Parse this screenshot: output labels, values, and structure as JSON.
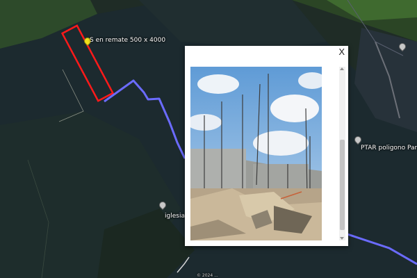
{
  "map": {
    "labels": {
      "plot": "S en remate 500 x 4000",
      "ptar": "PTAR poligono Paraiso",
      "church": "iglesia de",
      "copyright": "© 2024 ..."
    },
    "icons": {
      "plot_marker": "yellow-pushpin-icon",
      "ptar_marker": "place-pin-icon",
      "church_marker": "place-pin-icon",
      "top_marker": "place-pin-icon"
    },
    "colors": {
      "parcel_outline": "#ff1a1a",
      "route_line": "#6b6bff",
      "popup_background": "#ffffff"
    }
  },
  "popup": {
    "close_label": "X",
    "photo_subject": "construction site photo"
  }
}
